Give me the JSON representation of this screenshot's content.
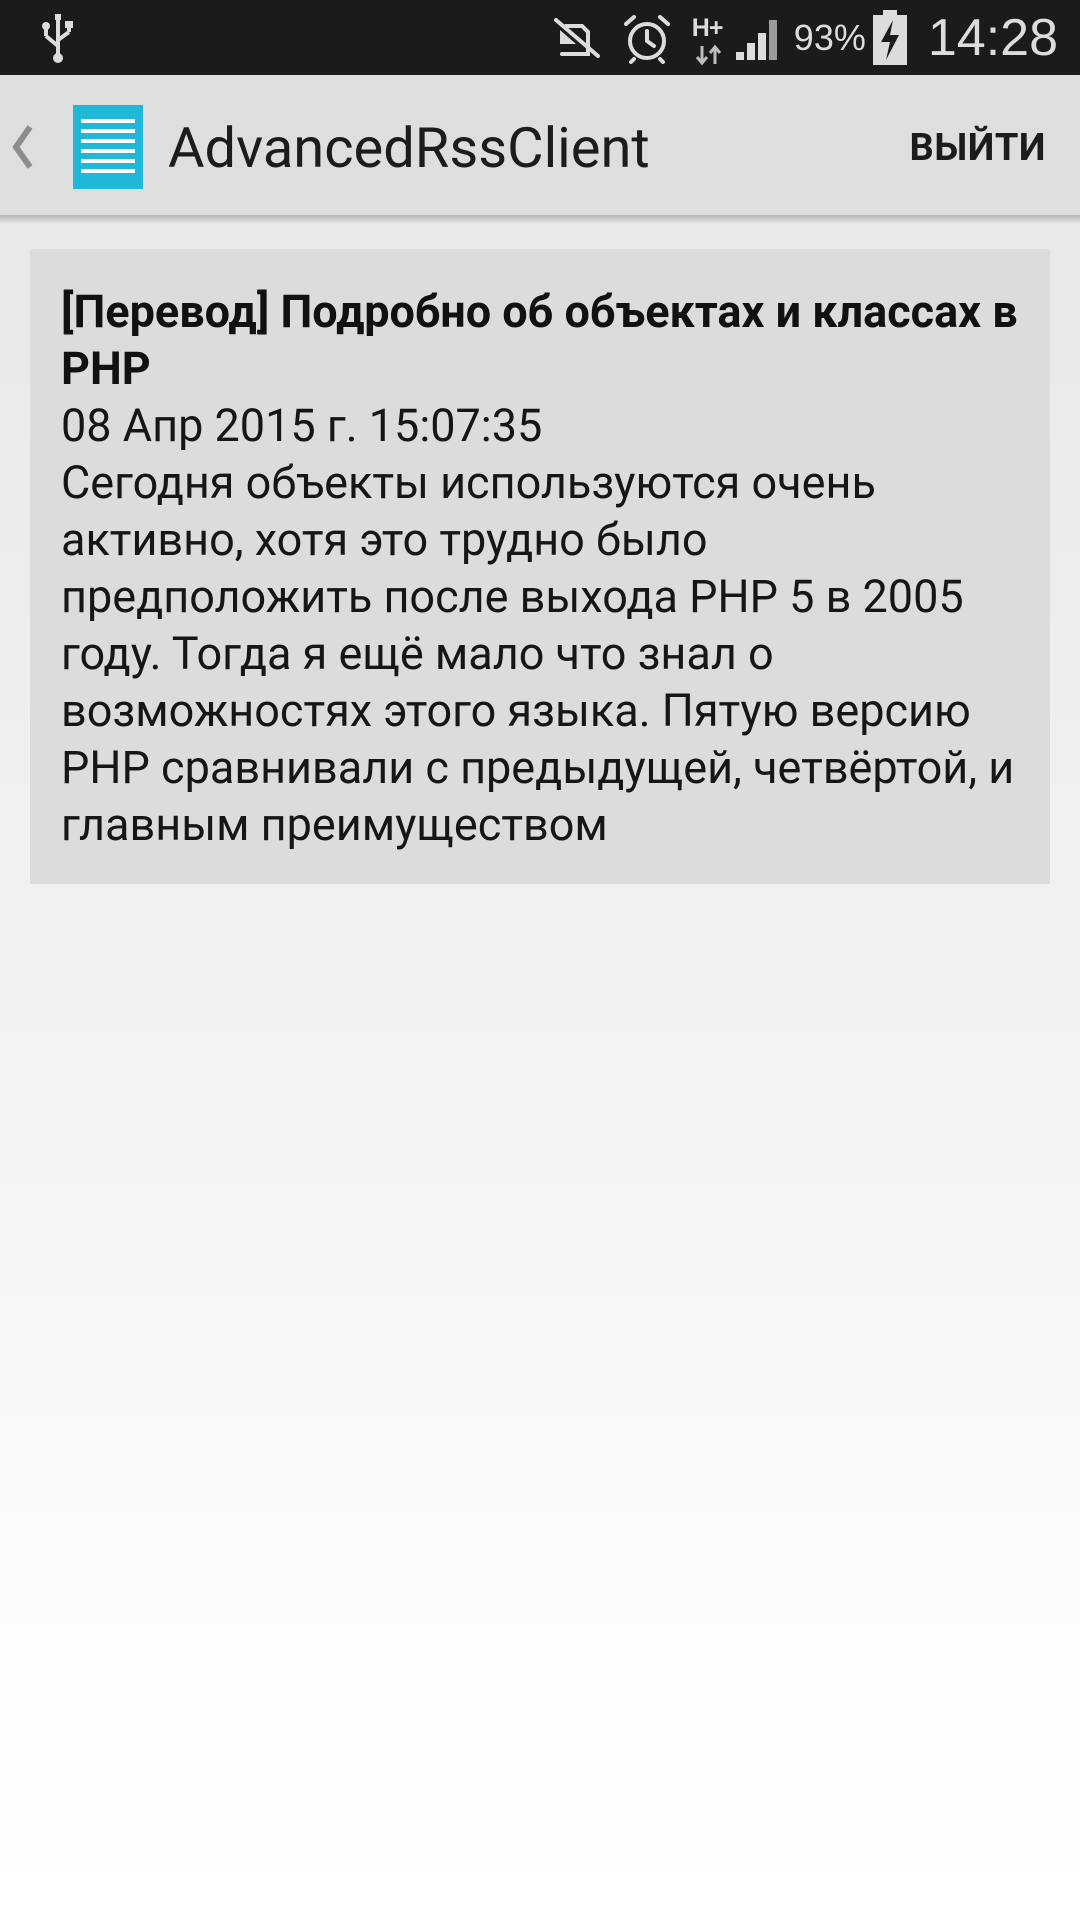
{
  "status_bar": {
    "icons": [
      "usb-icon",
      "mute-icon",
      "alarm-icon",
      "network-type-icon",
      "signal-icon",
      "battery-icon"
    ],
    "network_type": "H+",
    "battery_percent": "93%",
    "time": "14:28"
  },
  "action_bar": {
    "back_icon": "chevron-left-icon",
    "app_icon": "rss-list-icon",
    "app_icon_color": "#1fb8d8",
    "title": "AdvancedRssClient",
    "logout_label": "ВЫЙТИ"
  },
  "article": {
    "title": "[Перевод] Подробно об объектах и классах в PHP",
    "date": "08 Апр 2015 г. 15:07:35",
    "summary": "Сегодня объекты используются очень активно, хотя это трудно было предположить после выхода PHP 5 в 2005 году. Тогда я ещё мало что знал о возможностях этого языка. Пятую версию PHP сравнивали с предыдущей, четвёртой, и главным преимуществом"
  },
  "colors": {
    "status_bar_bg": "#1b1b1b",
    "action_bar_bg": "#dedede",
    "card_bg": "#dcdcdc",
    "accent": "#1fb8d8"
  }
}
